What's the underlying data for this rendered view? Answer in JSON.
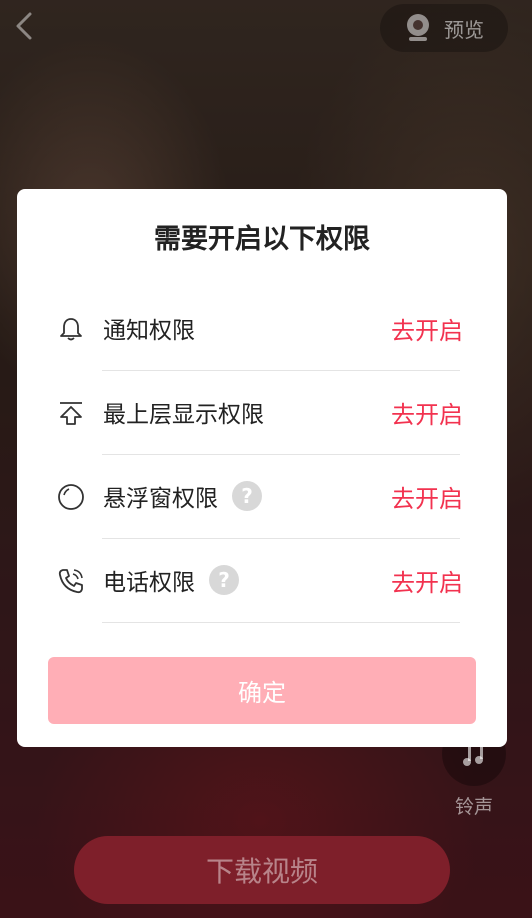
{
  "top_bar": {
    "back_icon": "chevron-left-icon",
    "preview_icon": "camera-icon",
    "preview_label": "预览"
  },
  "dialog": {
    "title": "需要开启以下权限",
    "permissions": [
      {
        "icon": "bell-icon",
        "label": "通知权限",
        "has_help": false,
        "action": "去开启"
      },
      {
        "icon": "upload-icon",
        "label": "最上层显示权限",
        "has_help": false,
        "action": "去开启"
      },
      {
        "icon": "circle-icon",
        "label": "悬浮窗权限",
        "has_help": true,
        "action": "去开启"
      },
      {
        "icon": "phone-icon",
        "label": "电话权限",
        "has_help": true,
        "action": "去开启"
      }
    ],
    "help_glyph": "?",
    "confirm_label": "确定"
  },
  "ringtone": {
    "icon": "music-note-icon",
    "label": "铃声"
  },
  "download_label": "下载视频",
  "colors": {
    "accent": "#f2324f",
    "confirm_bg": "#ffaeb6",
    "download_bg": "#7e1f2a"
  }
}
